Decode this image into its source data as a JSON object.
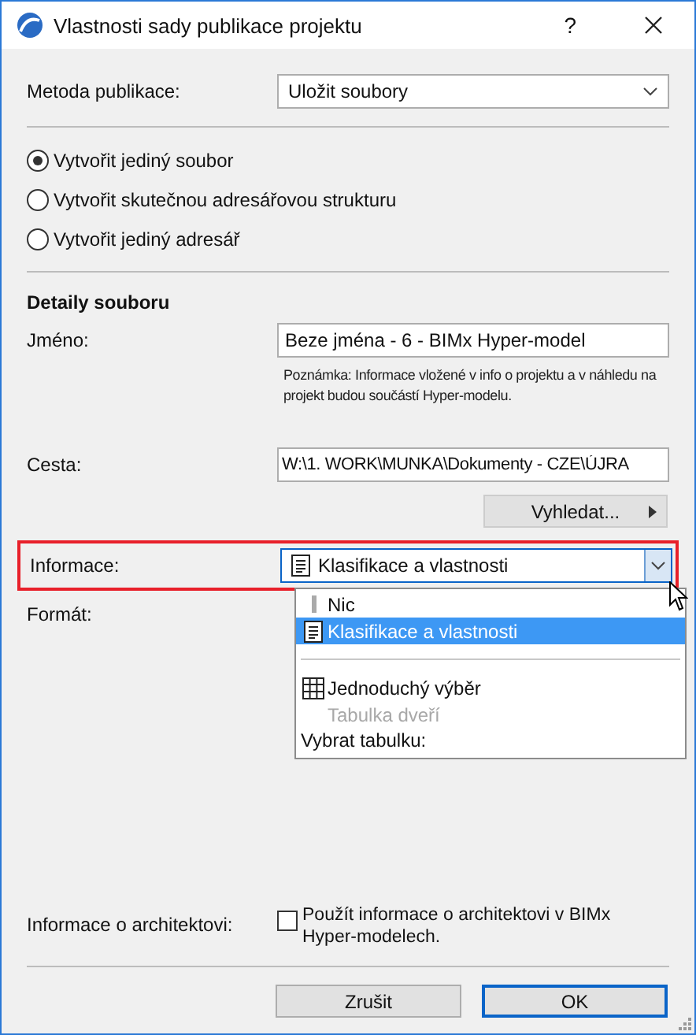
{
  "window": {
    "title": "Vlastnosti sady publikace projektu",
    "help": "?"
  },
  "method": {
    "label": "Metoda publikace:",
    "value": "Uložit soubory"
  },
  "options": [
    {
      "label": "Vytvořit jediný soubor",
      "selected": true
    },
    {
      "label": "Vytvořit skutečnou adresářovou strukturu",
      "selected": false
    },
    {
      "label": "Vytvořit jediný adresář",
      "selected": false
    }
  ],
  "details": {
    "heading": "Detaily souboru",
    "name_label": "Jméno:",
    "name_value": "Beze jména - 6 - BIMx Hyper-model",
    "note": "Poznámka: Informace vložené v info o projektu a v náhledu na projekt budou součástí Hyper-modelu.",
    "path_label": "Cesta:",
    "path_value": "W:\\1. WORK\\MUNKA\\Dokumenty - CZE\\ÚJRA",
    "browse": "Vyhledat..."
  },
  "information": {
    "label": "Informace:",
    "value": "Klasifikace a vlastnosti",
    "highlighted": true,
    "expanded": true,
    "menu": [
      {
        "kind": "plain",
        "label": "Nic",
        "selected": false,
        "disabled": false
      },
      {
        "kind": "list",
        "label": "Klasifikace a vlastnosti",
        "selected": true,
        "disabled": false
      },
      {
        "kind": "separator"
      },
      {
        "kind": "table",
        "label": "Jednoduchý výběr",
        "selected": false,
        "disabled": false
      },
      {
        "kind": "text",
        "label": "Tabulka dveří",
        "selected": false,
        "disabled": true
      },
      {
        "kind": "heading",
        "label": "Vybrat tabulku:"
      }
    ]
  },
  "format": {
    "label": "Formát:"
  },
  "architect": {
    "label": "Informace o architektovi:",
    "checkbox_label": "Použít informace o architektovi v BIMx Hyper-modelech.",
    "checked": false
  },
  "buttons": [
    {
      "label": "Zrušit",
      "default": false
    },
    {
      "label": "OK",
      "default": true
    }
  ]
}
